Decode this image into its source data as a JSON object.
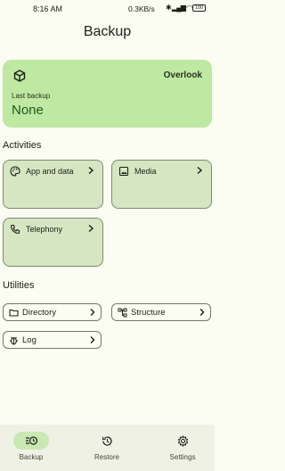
{
  "status_bar": {
    "time": "8:16 AM",
    "network": "0.3KB/s",
    "battery": "100"
  },
  "page_title": "Backup",
  "hero": {
    "app_name": "Overlook",
    "last_backup_label": "Last backup",
    "last_backup_value": "None"
  },
  "sections": {
    "activities": "Activities",
    "utilities": "Utilities"
  },
  "activities": [
    {
      "label": "App and data",
      "icon": "palette-icon"
    },
    {
      "label": "Media",
      "icon": "image-icon"
    },
    {
      "label": "Telephony",
      "icon": "phone-icon"
    }
  ],
  "utilities": [
    {
      "label": "Directory",
      "icon": "folder-icon"
    },
    {
      "label": "Structure",
      "icon": "tree-icon"
    },
    {
      "label": "Log",
      "icon": "bug-icon"
    }
  ],
  "nav": [
    {
      "label": "Backup",
      "icon": "backup-icon",
      "active": true
    },
    {
      "label": "Restore",
      "icon": "restore-icon",
      "active": false
    },
    {
      "label": "Settings",
      "icon": "gear-icon",
      "active": false
    }
  ],
  "colors": {
    "accent": "#bfe8a2",
    "card": "#d6e6c3",
    "background": "#fbfcf2",
    "value": "#1c5a1c"
  }
}
